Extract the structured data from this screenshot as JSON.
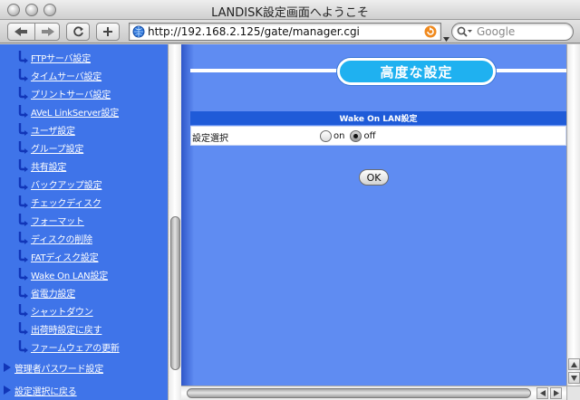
{
  "window": {
    "title": "LANDISK設定画面へようこそ"
  },
  "toolbar": {
    "url": "http://192.168.2.125/gate/manager.cgi",
    "search_placeholder": "Google",
    "icons": [
      "back-icon",
      "forward-icon",
      "reload-icon",
      "add-bookmark-icon",
      "globe-icon",
      "snapback-icon",
      "search-icon"
    ]
  },
  "sidebar": {
    "items": [
      {
        "label": "FTPサーバ設定"
      },
      {
        "label": "タイムサーバ設定"
      },
      {
        "label": "プリントサーバ設定"
      },
      {
        "label": "AVeL LinkServer設定"
      },
      {
        "label": "ユーザ設定"
      },
      {
        "label": "グループ設定"
      },
      {
        "label": "共有設定"
      },
      {
        "label": "バックアップ設定"
      },
      {
        "label": "チェックディスク"
      },
      {
        "label": "フォーマット"
      },
      {
        "label": "ディスクの削除"
      },
      {
        "label": "FATディスク設定"
      },
      {
        "label": "Wake On LAN設定"
      },
      {
        "label": "省電力設定"
      },
      {
        "label": "シャットダウン"
      },
      {
        "label": "出荷時設定に戻す"
      },
      {
        "label": "ファームウェアの更新"
      }
    ],
    "top_items": [
      {
        "label": "管理者パスワード設定"
      },
      {
        "label": "設定選択に戻る"
      }
    ]
  },
  "main": {
    "page_title": "高度な設定",
    "section_header": "Wake On LAN設定",
    "row_label": "設定選択",
    "options": [
      {
        "label": "on",
        "selected": false
      },
      {
        "label": "off",
        "selected": true
      }
    ],
    "ok_label": "OK"
  },
  "colors": {
    "sidebar_bg": "#3f74e9",
    "content_bg": "#5f8cf2",
    "section_header_bg": "#1f5bd8",
    "title_pill_bg": "#1fb1f0"
  }
}
